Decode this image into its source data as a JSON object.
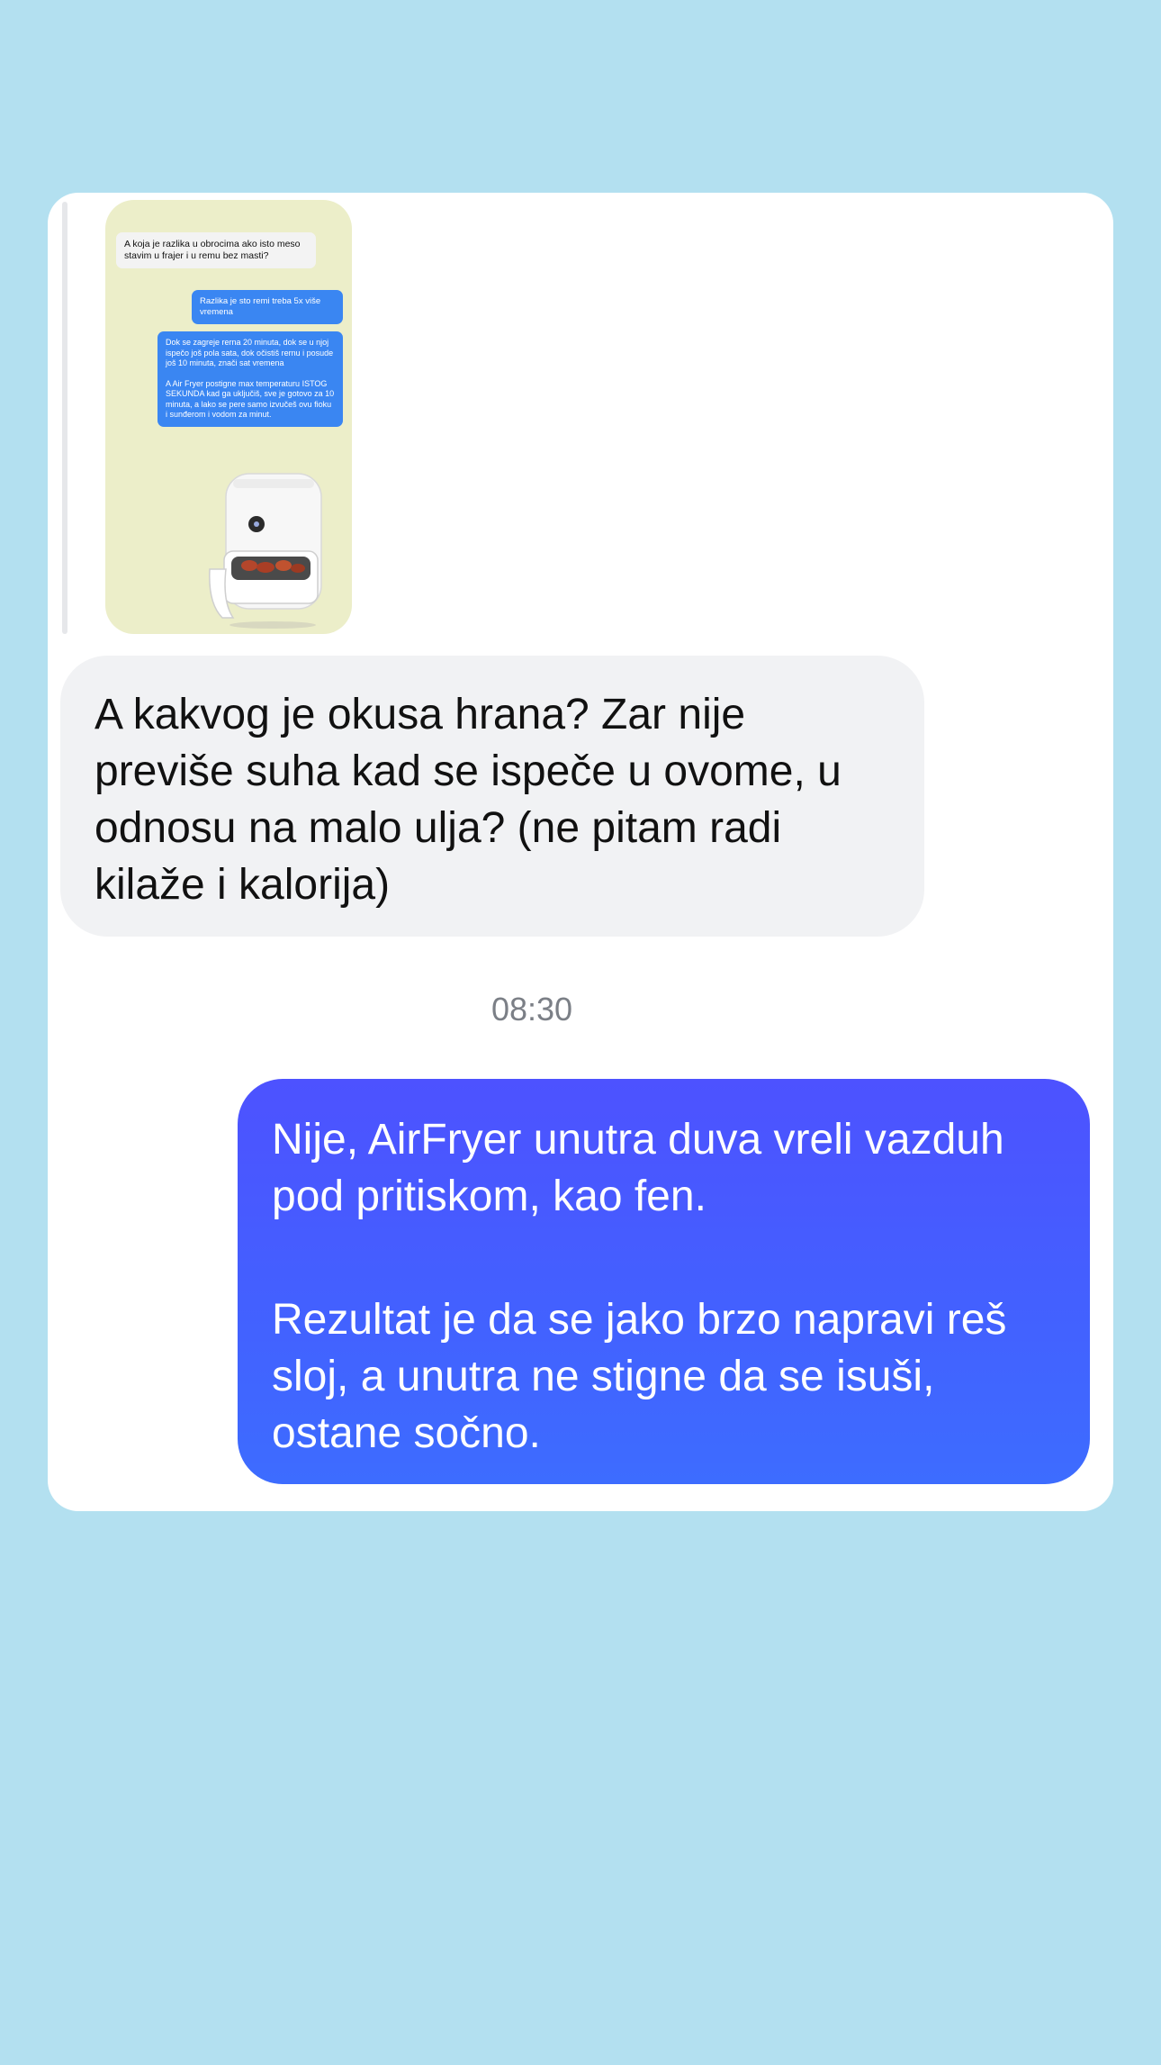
{
  "thread": {
    "quoted_screenshot": {
      "incoming": "A koja je razlika u obrocima ako isto meso stavim u frajer i u remu bez masti?",
      "outgoing_1": "Razlika je sto remi treba 5x više vremena",
      "outgoing_2_a": "Dok se zagreje rerna 20 minuta, dok se u njoj ispečo još pola sata, dok očistiš rernu i posude još 10 minuta, znači sat vremena",
      "outgoing_2_b": "A Air Fryer postigne max temperaturu ISTOG SEKUNDA kad ga uključiš, sve je gotovo za 10 minuta, a lako se pere samo izvučeš ovu fioku i sunđerom i vodom za minut.",
      "image_icon": "air-fryer-icon"
    },
    "incoming_message": "A kakvog je okusa hrana? Zar nije previše suha kad se ispeče u ovome, u odnosu na malo ulja? (ne pitam radi kilaže i kalorija)",
    "timestamp": "08:30",
    "outgoing_message": {
      "paragraph_1": "Nije, AirFryer unutra duva vreli vazduh pod pritiskom, kao fen.",
      "paragraph_2": "Rezultat je da se jako brzo napravi reš sloj, a unutra ne stigne da se isuši, ostane sočno."
    }
  },
  "colors": {
    "background": "#b3e0f0",
    "card": "#ffffff",
    "incoming_bubble": "#f1f2f4",
    "outgoing_bubble_top": "#4d52ff",
    "outgoing_bubble_bottom": "#3d6cff",
    "timestamp": "#7b7f86"
  }
}
